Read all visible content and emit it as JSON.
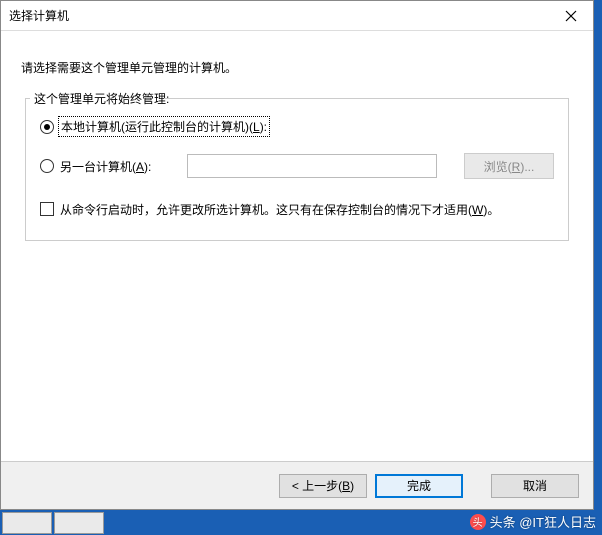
{
  "titlebar": {
    "title": "选择计算机"
  },
  "content": {
    "instruction": "请选择需要这个管理单元管理的计算机。",
    "group_legend": "这个管理单元将始终管理:",
    "radio_local_prefix": "本地计算机(运行此控制台的计算机)(",
    "radio_local_key": "L",
    "radio_local_suffix": "):",
    "radio_another_prefix": "另一台计算机(",
    "radio_another_key": "A",
    "radio_another_suffix": "):",
    "browse_prefix": "浏览(",
    "browse_key": "R",
    "browse_suffix": ")...",
    "checkbox_prefix": "从命令行启动时，允许更改所选计算机。这只有在保存控制台的情况下才适用(",
    "checkbox_key": "W",
    "checkbox_suffix": ")。",
    "another_value": ""
  },
  "buttons": {
    "back_prefix": "< 上一步(",
    "back_key": "B",
    "back_suffix": ")",
    "finish": "完成",
    "cancel": "取消"
  },
  "watermark": {
    "text": "头条 @IT狂人日志",
    "icon": "头"
  }
}
